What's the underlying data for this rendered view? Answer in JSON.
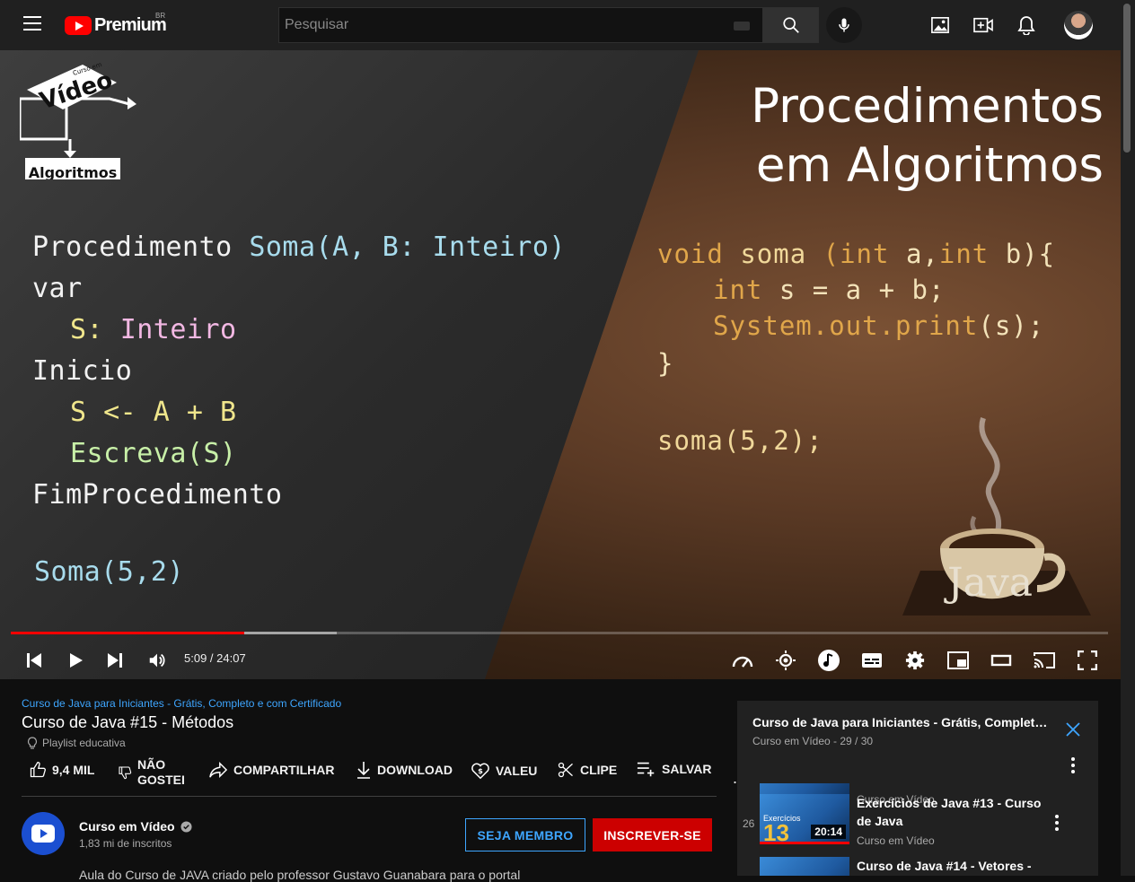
{
  "topbar": {
    "logo_text": "Premium",
    "region": "BR",
    "search_placeholder": "Pesquisar"
  },
  "video": {
    "slide": {
      "title_line1": "Procedimentos",
      "title_line2": "em Algoritmos",
      "logo_text": "Vídeo",
      "logo_small": "Curso em",
      "logo_tag": "Algoritmos",
      "java_label": "Java",
      "pseudo": {
        "l1_a": "Procedimento ",
        "l1_b": "Soma(A, B: Inteiro)",
        "l2": "var",
        "l3_a": "S: ",
        "l3_b": "Inteiro",
        "l4": "Inicio",
        "l5": "S <- A + B",
        "l6": "Escreva(S)",
        "l7": "FimProcedimento",
        "l8": "Soma(5,2)"
      },
      "java_code": {
        "l1_a": "void ",
        "l1_b": "soma ",
        "l1_c": "(int ",
        "l1_d": "a,",
        "l1_e": "int ",
        "l1_f": "b){",
        "l2_a": "int ",
        "l2_b": "s = a + b;",
        "l3_a": "System.out.print",
        "l3_b": "(s);",
        "l4": "}",
        "l5": "soma(5,2);"
      }
    },
    "time_text": "5:09 / 24:07",
    "progress_played": 0.213,
    "progress_buffered": 0.297
  },
  "info": {
    "playlist_link": "Curso de Java para Iniciantes - Grátis, Completo e com Certificado",
    "title": "Curso de Java #15 - Métodos",
    "edu_badge": "Playlist educativa",
    "actions": {
      "like": "9,4 MIL",
      "dislike_line1": "NÃO",
      "dislike_line2": "GOSTEI",
      "share": "COMPARTILHAR",
      "download": "DOWNLOAD",
      "thanks": "VALEU",
      "clip": "CLIPE",
      "save": "SALVAR",
      "more": "..."
    },
    "channel": {
      "name": "Curso em Vídeo",
      "subs": "1,83 mi de inscritos",
      "member_btn": "SEJA MEMBRO",
      "subscribe_btn": "INSCREVER-SE"
    },
    "description": "Aula do Curso de JAVA criado pelo professor Gustavo Guanabara para o portal"
  },
  "playlist": {
    "title": "Curso de Java para Iniciantes - Grátis, Completo e ...",
    "subtitle": "Curso em Vídeo - 29 / 30",
    "items": [
      {
        "index": "",
        "title": "",
        "channel": "Curso em Vídeo",
        "duration": ""
      },
      {
        "index": "26",
        "title": "Exercícios de Java #13 - Curso de Java",
        "channel": "Curso em Vídeo",
        "duration": "20:14",
        "thumb_text": "13",
        "thumb_label": "Exercícios"
      },
      {
        "index": "",
        "title": "Curso de Java #14 - Vetores -",
        "channel": "",
        "duration": ""
      }
    ]
  },
  "colors": {
    "accent_red": "#ff0000",
    "link_blue": "#3ea6ff",
    "subscribe_red": "#cc0000"
  }
}
